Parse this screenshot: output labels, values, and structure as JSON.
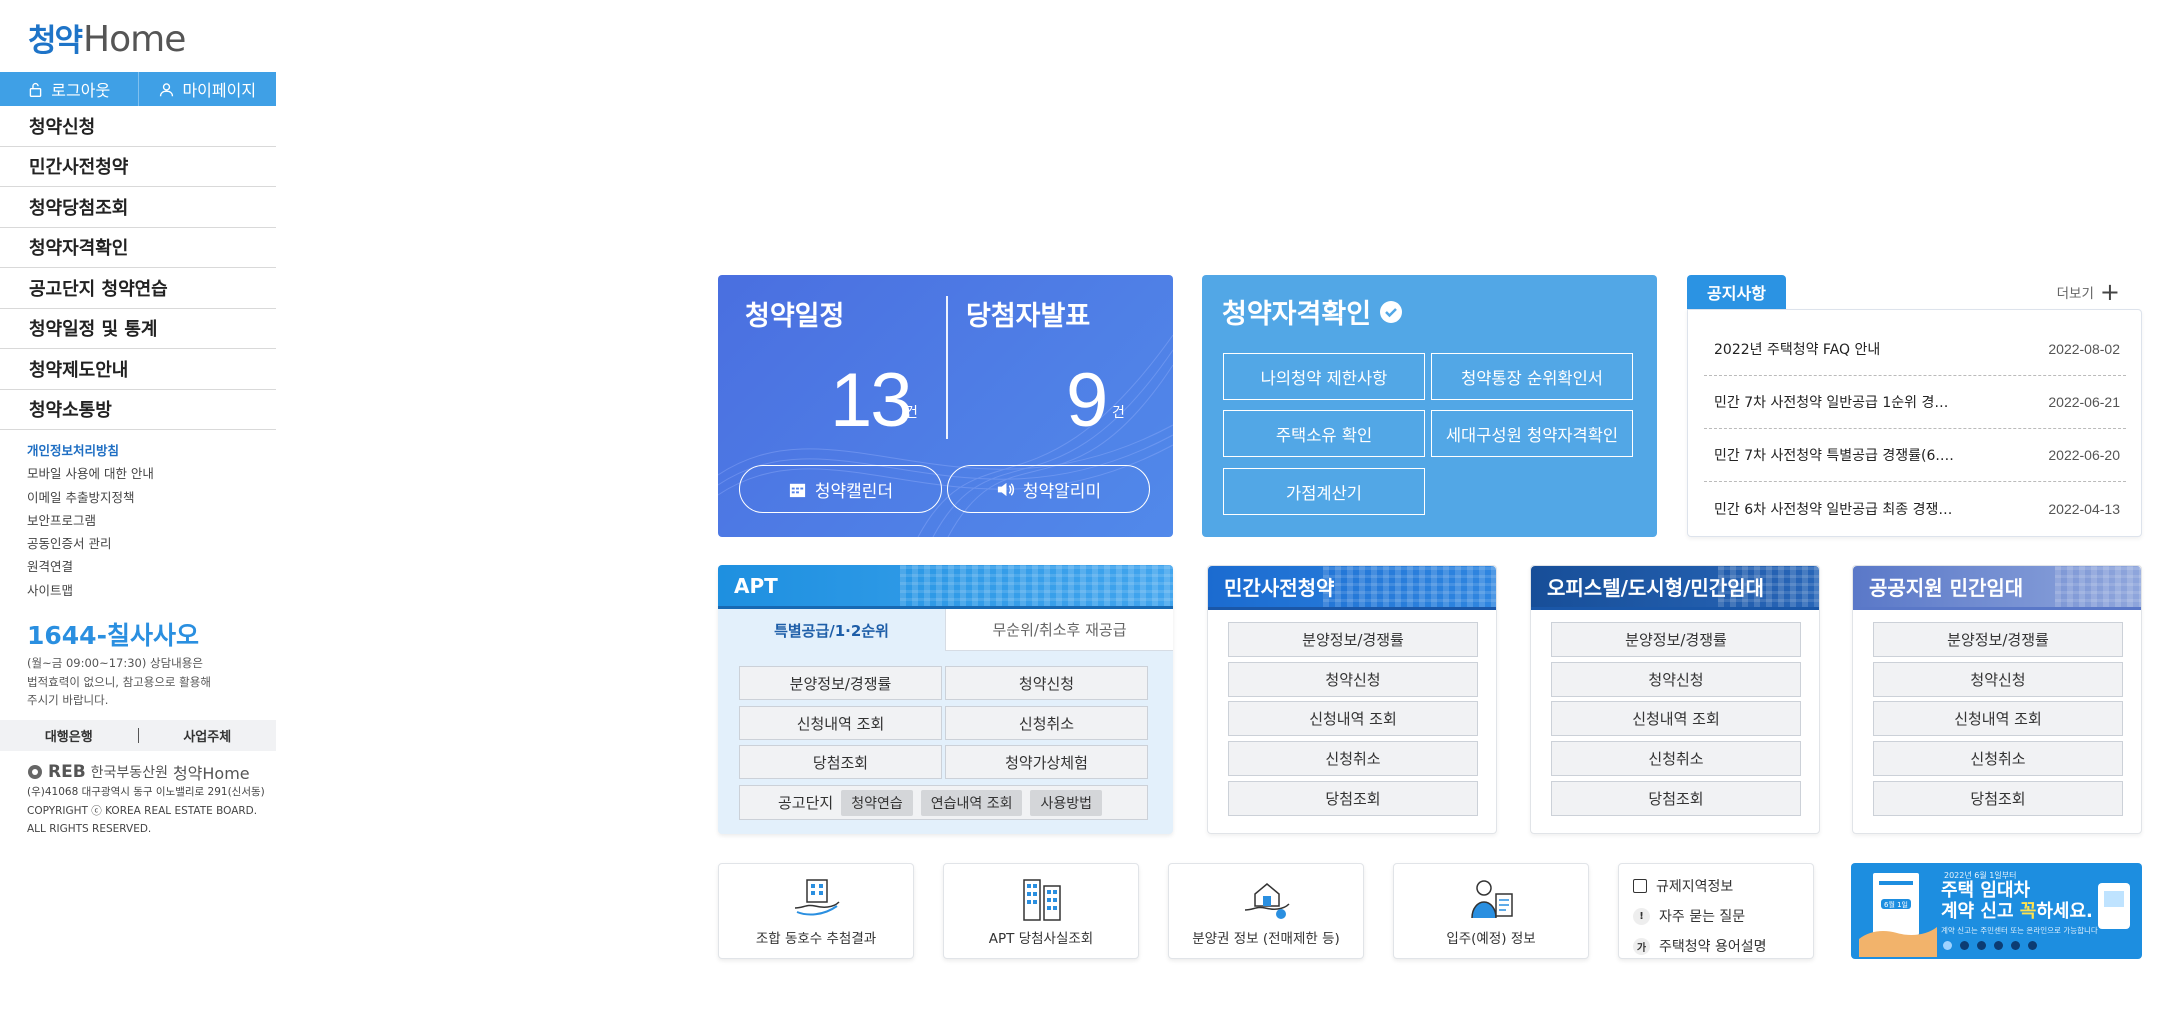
{
  "sidebar": {
    "logo_ko": "청약",
    "logo_en": "Home",
    "logout": "로그아웃",
    "mypage": "마이페이지",
    "menu": [
      "청약신청",
      "민간사전청약",
      "청약당첨조회",
      "청약자격확인",
      "공고단지 청약연습",
      "청약일정 및 통계",
      "청약제도안내",
      "청약소통방"
    ],
    "sublinks": [
      "개인정보처리방침",
      "모바일 사용에 대한 안내",
      "이메일 추출방지정책",
      "보안프로그램",
      "공동인증서 관리",
      "원격연결",
      "사이트맵"
    ],
    "phone": "1644-칠사사오",
    "phone_note_1": "(월~금 09:00~17:30) 상담내용은",
    "phone_note_2": "법적효력이 없으니, 참고용으로 활용해",
    "phone_note_3": "주시기 바랍니다.",
    "bank": "대행은행",
    "operator": "사업주체",
    "footer_reb": "REB",
    "footer_org": "한국부동산원",
    "footer_home": "청약Home",
    "address": "(우)41068 대구광역시 동구 이노밸리로 291(신서동)",
    "copyright_1": "COPYRIGHT ⓒ KOREA REAL ESTATE BOARD.",
    "copyright_2": "ALL RIGHTS RESERVED."
  },
  "schedule": {
    "left_title": "청약일정",
    "left_count": "13",
    "right_title": "당첨자발표",
    "right_count": "9",
    "unit": "건",
    "calendar_btn": "청약캘린더",
    "alarm_btn": "청약알리미"
  },
  "qualification": {
    "title": "청약자격확인",
    "buttons": [
      "나의청약 제한사항",
      "청약통장 순위확인서",
      "주택소유 확인",
      "세대구성원 청약자격확인",
      "가점계산기"
    ]
  },
  "notice": {
    "tab": "공지사항",
    "more": "더보기",
    "items": [
      {
        "title": "2022년 주택청약 FAQ 안내",
        "date": "2022-08-02"
      },
      {
        "title": "민간 7차 사전청약 일반공급 1순위 경…",
        "date": "2022-06-21"
      },
      {
        "title": "민간 7차 사전청약 특별공급 경쟁률(6.…",
        "date": "2022-06-20"
      },
      {
        "title": "민간 6차 사전청약 일반공급 최종 경쟁…",
        "date": "2022-04-13"
      }
    ]
  },
  "apt": {
    "title": "APT",
    "tab_on": "특별공급/1·2순위",
    "tab_off": "무순위/취소후 재공급",
    "buttons": [
      "분양정보/경쟁률",
      "청약신청",
      "신청내역 조회",
      "신청취소",
      "당첨조회",
      "청약가상체험"
    ],
    "complex_label": "공고단지",
    "chips": [
      "청약연습",
      "연습내역 조회",
      "사용방법"
    ]
  },
  "panels": [
    {
      "title": "민간사전청약",
      "buttons": [
        "분양정보/경쟁률",
        "청약신청",
        "신청내역 조회",
        "신청취소",
        "당첨조회"
      ]
    },
    {
      "title": "오피스텔/도시형/민간임대",
      "buttons": [
        "분양정보/경쟁률",
        "청약신청",
        "신청내역 조회",
        "신청취소",
        "당첨조회"
      ]
    },
    {
      "title": "공공지원 민간임대",
      "buttons": [
        "분양정보/경쟁률",
        "청약신청",
        "신청내역 조회",
        "신청취소",
        "당첨조회"
      ]
    }
  ],
  "quick": [
    "조합 동호수 추첨결과",
    "APT 당첨사실조회",
    "분양권 정보 (전매제한 등)",
    "입주(예정) 정보"
  ],
  "links": [
    {
      "icon": "building-icon",
      "label": "규제지역정보"
    },
    {
      "icon": "exclamation-icon",
      "label": "자주 묻는 질문"
    },
    {
      "icon": "ga-icon",
      "label": "주택청약 용어설명"
    }
  ],
  "banner": {
    "small": "2022년 6월 1일부터",
    "line1": "주택 임대차",
    "line2a": "계약 신고 ",
    "line2b": "꼭",
    "line2c": "하세요.",
    "foot": "계약 신고는 주민센터 또는 온라인으로 가능합니다",
    "date_badge": "6월 1일"
  },
  "colors": {
    "accent": "#3fa0e6",
    "schedule_bg": "#4f7fe6",
    "qual_bg": "#52a7e6",
    "notice_tab": "#2b93e3"
  }
}
